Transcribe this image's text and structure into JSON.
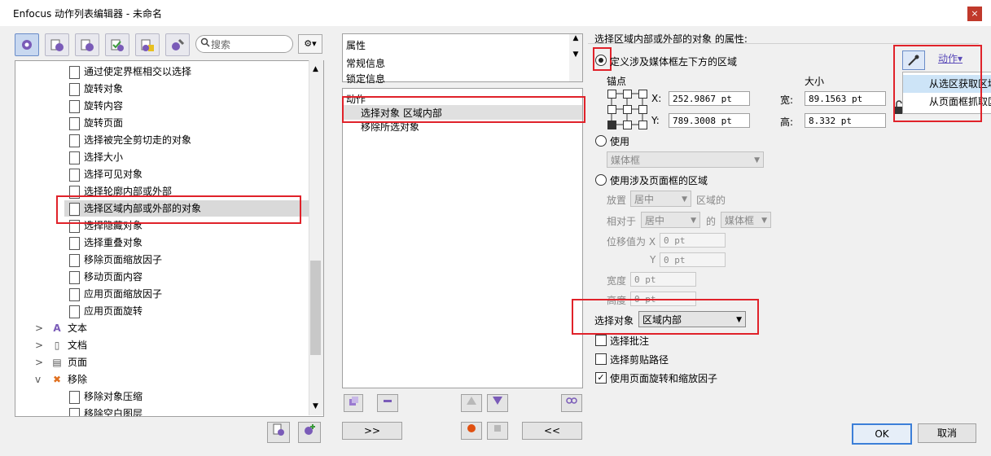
{
  "window": {
    "title": "Enfocus 动作列表编辑器 - 未命名",
    "close_label": "×"
  },
  "toolbar": {
    "search_placeholder": "搜索",
    "gear_label": "⚙▾"
  },
  "tree": {
    "items": [
      "通过使定界框相交以选择",
      "旋转对象",
      "旋转内容",
      "旋转页面",
      "选择被完全剪切走的对象",
      "选择大小",
      "选择可见对象",
      "选择轮廓内部或外部",
      "选择区域内部或外部的对象",
      "选择隐藏对象",
      "选择重叠对象",
      "移除页面缩放因子",
      "移动页面内容",
      "应用页面缩放因子",
      "应用页面旋转"
    ],
    "groups": [
      {
        "label": "文本",
        "toggle": ">"
      },
      {
        "label": "文档",
        "toggle": ">"
      },
      {
        "label": "页面",
        "toggle": ">"
      },
      {
        "label": "移除",
        "toggle": "v"
      }
    ],
    "children": [
      "移除对象压缩",
      "移除空白图层"
    ]
  },
  "middle": {
    "tabs": [
      "属性",
      "常规信息",
      "锁定信息"
    ],
    "action_header": "动作",
    "actions": [
      "选择对象 区域内部",
      "移除所选对象"
    ],
    "btn_forward": ">>",
    "btn_back": "<<"
  },
  "props": {
    "heading": "选择区域内部或外部的对象 的属性:",
    "radio1": "定义涉及媒体框左下方的区域",
    "anchor_label": "锚点",
    "size_label": "大小",
    "x_label": "X:",
    "y_label": "Y:",
    "x_value": "252.9867 pt",
    "y_value": "789.3008 pt",
    "width_label": "宽:",
    "height_label": "高:",
    "width_value": "89.1563 pt",
    "height_value": "8.332 pt",
    "radio2": "使用",
    "use_combo": "媒体框",
    "radio3": "使用涉及页面框的区域",
    "place_label": "放置",
    "place_combo": "居中",
    "place_suffix": "区域的",
    "relative_label": "相对于",
    "relative_combo": "居中",
    "of_label": "的",
    "of_combo": "媒体框",
    "offset_label": "位移值为 X",
    "offset_x": "0 pt",
    "offset_y_label": "Y",
    "offset_y": "0 pt",
    "w2_label": "宽度",
    "w2_value": "0 pt",
    "h2_label": "高度",
    "h2_value": "0 pt",
    "select_label": "选择对象",
    "select_value": "区域内部",
    "check1": "选择批注",
    "check2": "选择剪贴路径",
    "check3": "使用页面旋转和缩放因子"
  },
  "actions_menu": {
    "label": "动作▾",
    "items": [
      "从选区获取区域",
      "从页面框抓取区域"
    ]
  },
  "footer": {
    "ok": "OK",
    "cancel": "取消"
  }
}
